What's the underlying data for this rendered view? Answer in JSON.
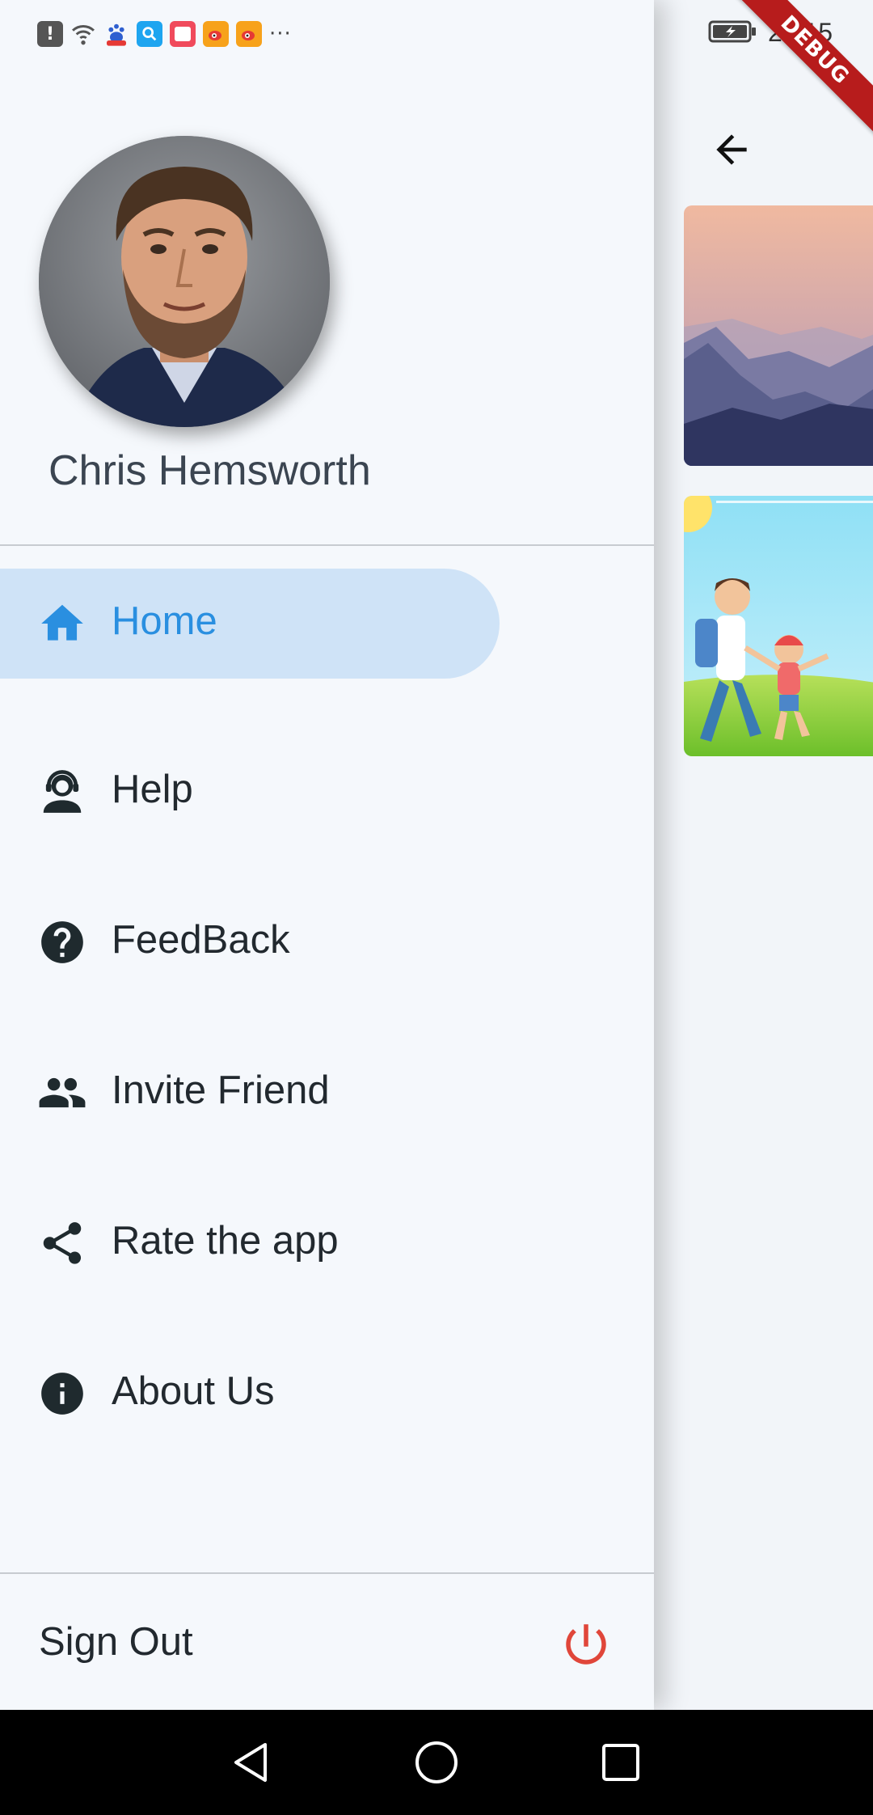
{
  "status_bar": {
    "time": "22:15",
    "left_icons": [
      "alert-icon",
      "wifi-icon",
      "baidu-icon",
      "search-app-icon",
      "notes-app-icon",
      "weibo-icon",
      "weibo-icon"
    ],
    "more": "···"
  },
  "debug_banner": "DEBUG",
  "drawer": {
    "user_name": "Chris Hemsworth",
    "menu": [
      {
        "label": "Home",
        "icon": "home-icon",
        "active": true
      },
      {
        "label": "Help",
        "icon": "support-agent-icon",
        "active": false
      },
      {
        "label": "FeedBack",
        "icon": "help-circle-icon",
        "active": false
      },
      {
        "label": "Invite Friend",
        "icon": "people-icon",
        "active": false
      },
      {
        "label": "Rate the app",
        "icon": "share-icon",
        "active": false
      },
      {
        "label": "About Us",
        "icon": "info-icon",
        "active": false
      }
    ],
    "sign_out_label": "Sign Out"
  },
  "colors": {
    "accent": "#2a8fe0",
    "active_bg": "#cfe3f7",
    "power": "#e0463a",
    "drawer_bg": "#f5f8fc"
  }
}
